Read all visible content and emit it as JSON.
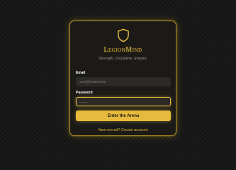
{
  "brand": {
    "name": "LegionMind",
    "tagline": "Strength. Discipline. Empire.",
    "logo_icon": "shield-icon"
  },
  "form": {
    "email_label": "Email",
    "email_placeholder": "your@email.com",
    "email_value": "",
    "password_label": "Password",
    "password_value": "........",
    "submit_label": "Enter the Arena",
    "create_account_link": "New recruit? Create account"
  },
  "colors": {
    "accent": "#e5ba3d",
    "background": "#151515",
    "card": "#1b1a17"
  }
}
